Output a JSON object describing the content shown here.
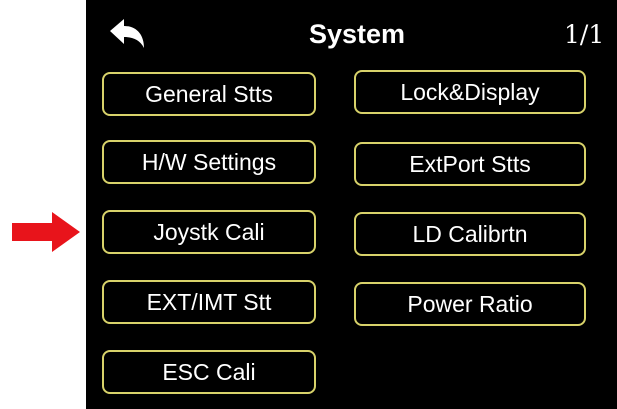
{
  "header": {
    "title": "System",
    "page_indicator": "1/1",
    "back_icon": "back-arrow-icon"
  },
  "indicator": {
    "icon": "right-arrow-icon",
    "color": "#e8141b",
    "points_to": "Joystk Cali"
  },
  "colors": {
    "screen_background": "#000000",
    "button_border": "#d8d26a",
    "text": "#ffffff"
  },
  "menu": {
    "items": [
      {
        "label": "General Stts"
      },
      {
        "label": "Lock&Display"
      },
      {
        "label": "H/W Settings"
      },
      {
        "label": "ExtPort Stts"
      },
      {
        "label": "Joystk Cali"
      },
      {
        "label": "LD Calibrtn"
      },
      {
        "label": "EXT/IMT Stt"
      },
      {
        "label": "Power Ratio"
      },
      {
        "label": "ESC Cali"
      }
    ]
  }
}
